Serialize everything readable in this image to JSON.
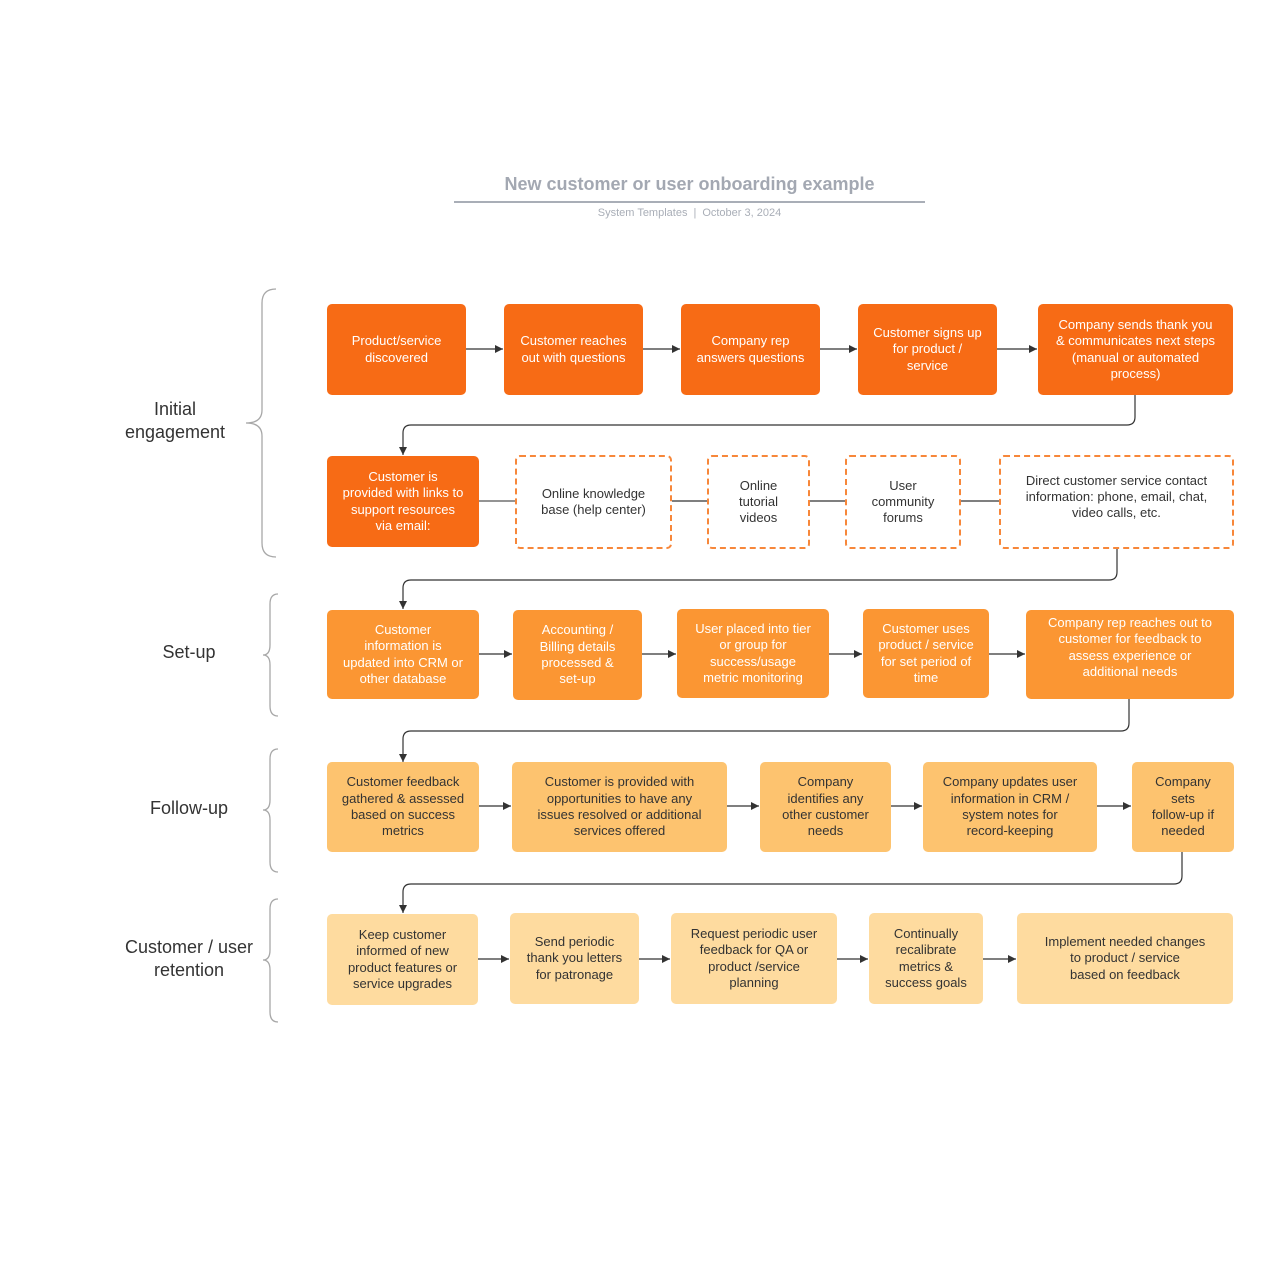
{
  "header": {
    "title": "New customer or user onboarding example",
    "author": "System Templates",
    "separator": "|",
    "date": "October 3, 2024"
  },
  "colors": {
    "stage1": "#f76b15",
    "stage2": "#fb9633",
    "stage3": "#fdc36f",
    "stage4": "#fedb9f",
    "dashed_border": "#f7873a",
    "connector": "#333333",
    "title": "#a3a8b2"
  },
  "phases": [
    {
      "label": "Initial\nengagement"
    },
    {
      "label": "Set-up"
    },
    {
      "label": "Follow-up"
    },
    {
      "label": "Customer / user\nretention"
    }
  ],
  "rows": [
    {
      "steps": [
        {
          "text": "Product/service\ndiscovered"
        },
        {
          "text": "Customer reaches\nout with questions"
        },
        {
          "text": "Company rep\nanswers questions"
        },
        {
          "text": "Customer signs up\nfor product /\nservice"
        },
        {
          "text": "Company sends thank you\n& communicates next steps\n(manual or automated\nprocess)"
        }
      ]
    },
    {
      "steps": [
        {
          "text": "Customer is\nprovided with links to\nsupport resources\nvia email:"
        },
        {
          "text": "Online knowledge\nbase (help center)"
        },
        {
          "text": "Online\ntutorial\nvideos"
        },
        {
          "text": "User\ncommunity\nforums"
        },
        {
          "text": "Direct customer service contact\ninformation: phone, email, chat,\nvideo calls, etc."
        }
      ]
    },
    {
      "steps": [
        {
          "text": "Customer\ninformation is\nupdated into CRM or\nother database"
        },
        {
          "text": "Accounting /\nBilling details\nprocessed &\nset-up"
        },
        {
          "text": "User placed into tier\nor group for\nsuccess/usage\nmetric monitoring"
        },
        {
          "text": "Customer uses\nproduct / service\nfor set period of\ntime"
        },
        {
          "text": "Company rep reaches out to\ncustomer for feedback to\nassess experience or\nadditional needs"
        }
      ]
    },
    {
      "steps": [
        {
          "text": "Customer feedback\ngathered & assessed\nbased on success\nmetrics"
        },
        {
          "text": "Customer is provided with\nopportunities to have any\nissues resolved or additional\nservices offered"
        },
        {
          "text": "Company\nidentifies any\nother customer\nneeds"
        },
        {
          "text": "Company updates user\ninformation in CRM /\nsystem notes for\nrecord-keeping"
        },
        {
          "text": "Company\nsets\nfollow-up if\nneeded"
        }
      ]
    },
    {
      "steps": [
        {
          "text": "Keep customer\ninformed of new\nproduct features or\nservice upgrades"
        },
        {
          "text": "Send periodic\nthank you letters\nfor patronage"
        },
        {
          "text": "Request periodic user\nfeedback for QA or\nproduct /service\nplanning"
        },
        {
          "text": "Continually\nrecalibrate\nmetrics &\nsuccess goals"
        },
        {
          "text": "Implement needed changes\nto product / service\nbased on feedback"
        }
      ]
    }
  ]
}
